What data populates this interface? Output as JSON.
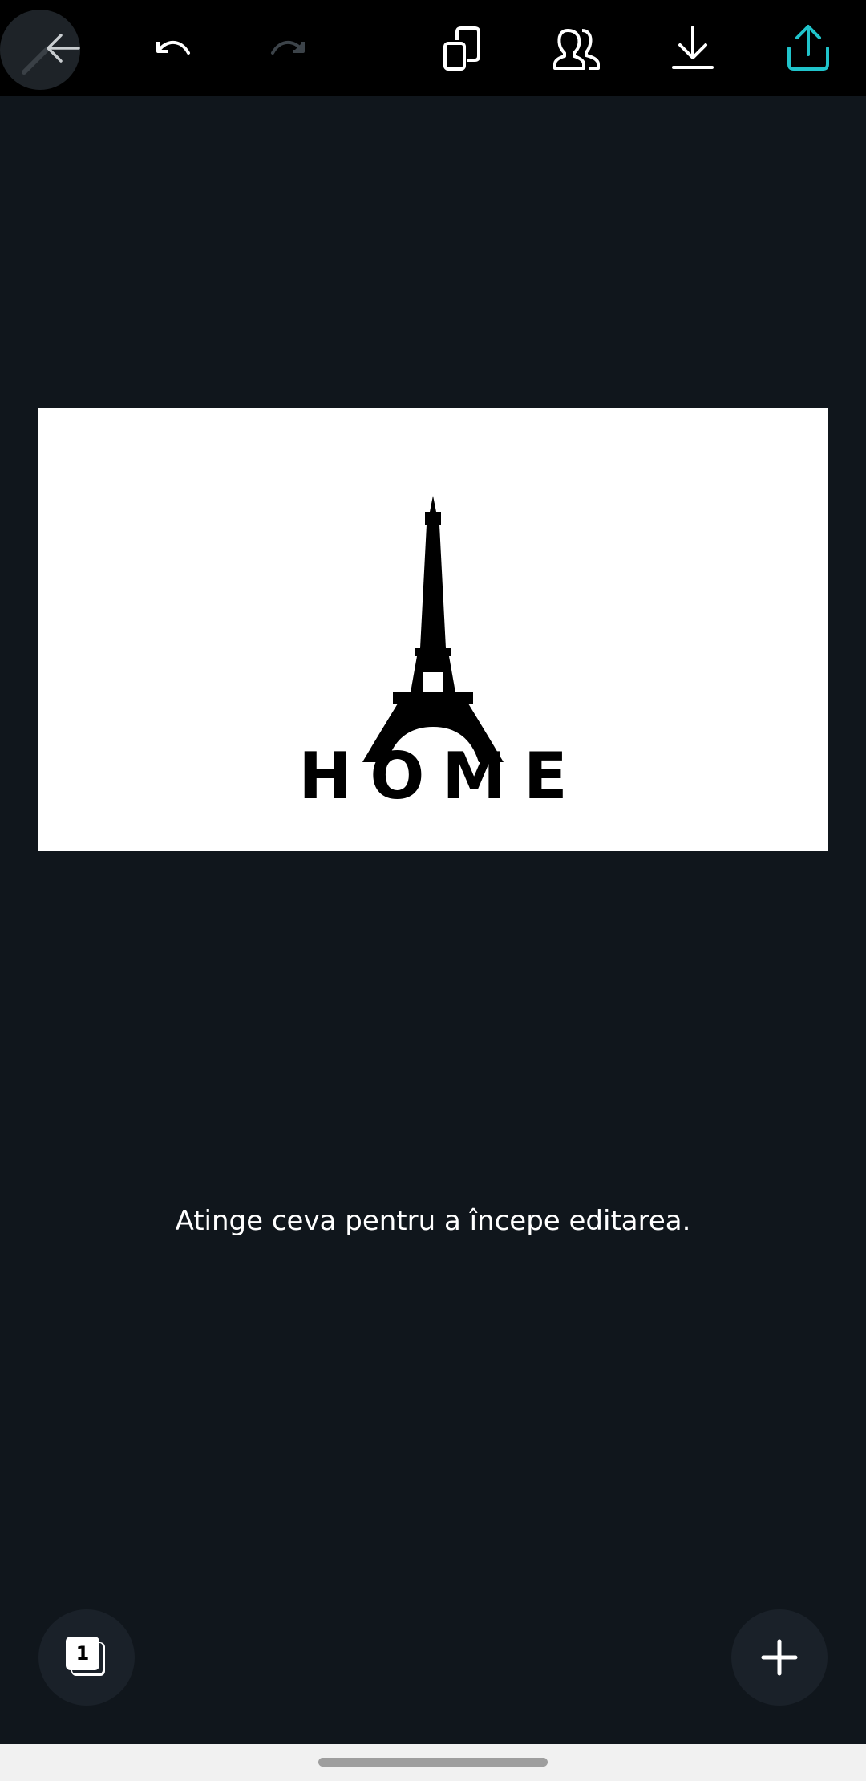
{
  "toolbar": {
    "icons": [
      "back-arrow-icon",
      "undo-icon",
      "redo-icon",
      "copy-icon",
      "collaborate-icon",
      "download-icon",
      "share-icon"
    ],
    "accent_color": "#20c4cb"
  },
  "design": {
    "text": "HOME",
    "image": "eiffel-tower-silhouette"
  },
  "hint": {
    "text": "Atinge ceva pentru a începe editarea."
  },
  "pages": {
    "count": "1"
  },
  "colors": {
    "background": "#10161c",
    "toolbar": "#000000",
    "button_bg": "#1a2129"
  }
}
